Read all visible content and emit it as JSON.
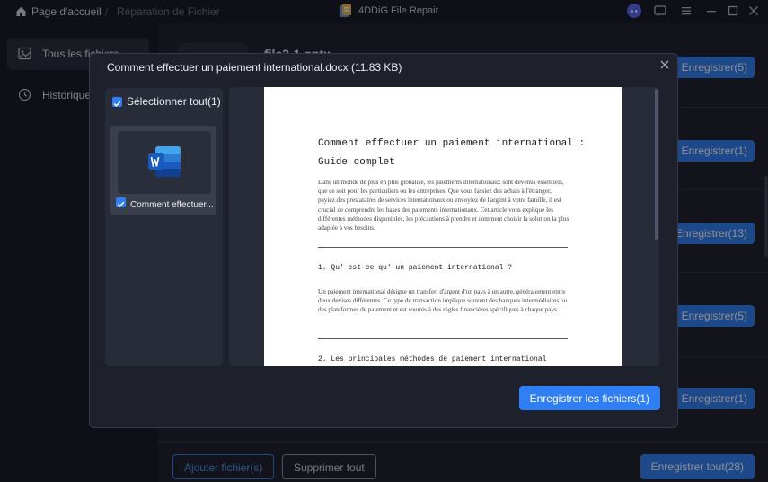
{
  "titlebar": {
    "home_label": "Page d'accueil",
    "separator": "/",
    "current_label": "Réparation de Fichier",
    "app_title": "4DDiG File Repair"
  },
  "sidebar": {
    "items": [
      {
        "label": "Tous les fichiers"
      },
      {
        "label": "Historique"
      }
    ]
  },
  "main": {
    "first_row_name": "file3-1.pptx",
    "rows": [
      {
        "button": "Enregistrer(5)"
      },
      {
        "button": "Enregistrer(1)"
      },
      {
        "button": "Enregistrer(13)"
      },
      {
        "button": "Enregistrer(5)"
      },
      {
        "button": "Enregistrer(1)"
      }
    ],
    "bottom": {
      "add_label": "Ajouter fichier(s)",
      "delete_label": "Supprimer tout",
      "save_all_label": "Enregistrer tout(28)"
    }
  },
  "dialog": {
    "title": "Comment effectuer un paiement international.docx",
    "size": "(11.83 KB)",
    "select_all": "Sélectionner tout(1)",
    "file_card_name": "Comment effectuer...",
    "save_button": "Enregistrer les fichiers(1)",
    "document": {
      "title_line1": "Comment effectuer un paiement international :",
      "title_line2": "Guide complet",
      "intro": "Dans un monde de plus en plus globalisé, les paiements internationaux sont devenus essentiels, que ce soit pour les particuliers ou les entreprises. Que vous fassiez des achats à l'étranger, payiez des prestataires de services internationaux ou envoyiez de l'argent à votre famille, il est crucial de comprendre les bases des paiements internationaux. Cet article vous explique les différentes méthodes disponibles, les précautions à prendre et comment choisir la solution la plus adaptée à vos besoins.",
      "h1": "1. Qu' est-ce qu' un paiement international ?",
      "p1": "Un paiement international désigne un transfert d'argent d'un pays à un autre, généralement entre deux devises différentes. Ce type de transaction implique souvent des banques intermédiaires ou des plateformes de paiement et est soumis à des règles financières spécifiques à chaque pays.",
      "h2": "2. Les principales méthodes de paiement international"
    }
  },
  "colors": {
    "accent": "#2f7ef3",
    "background": "#15171f",
    "dialog": "#1e212c"
  }
}
